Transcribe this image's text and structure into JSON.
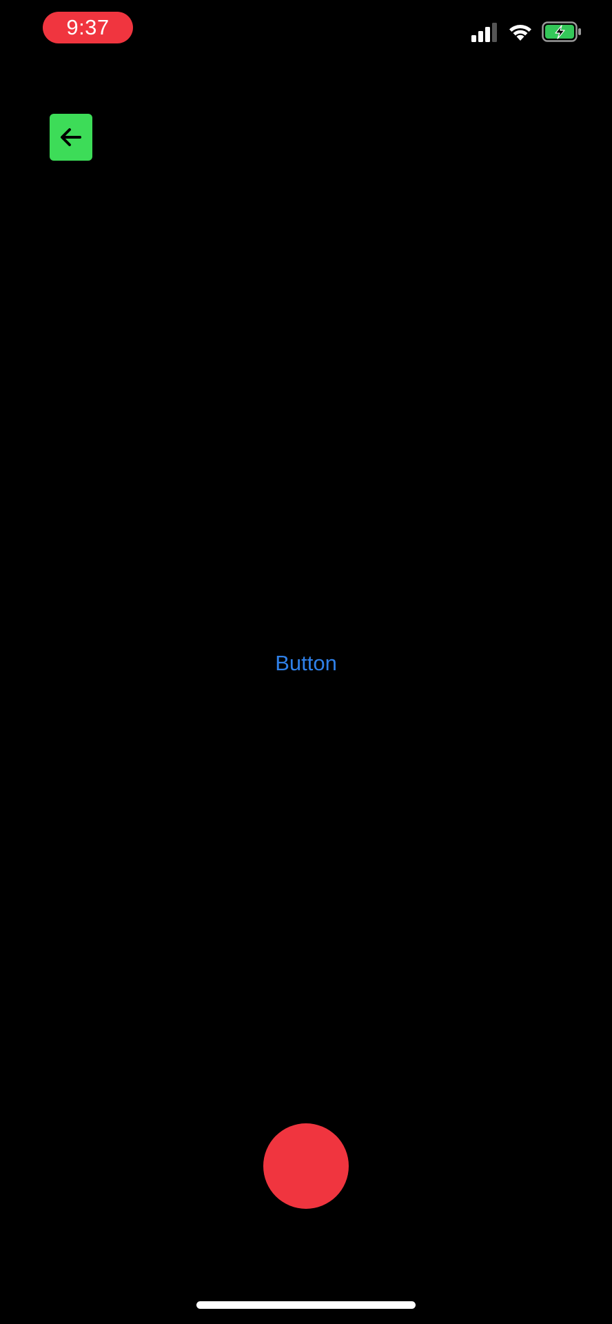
{
  "status_bar": {
    "time": "9:37",
    "time_pill_color": "#f0353f",
    "signal_icon": "cellular-signal-icon",
    "wifi_icon": "wifi-icon",
    "battery_icon": "battery-charging-icon",
    "battery_color": "#34c759"
  },
  "nav": {
    "back_icon": "arrow-left-icon",
    "back_button_color": "#3ddc58"
  },
  "main": {
    "button_label": "Button",
    "button_color": "#2f80e8"
  },
  "controls": {
    "record_icon": "record-button",
    "record_color": "#f0353f"
  }
}
